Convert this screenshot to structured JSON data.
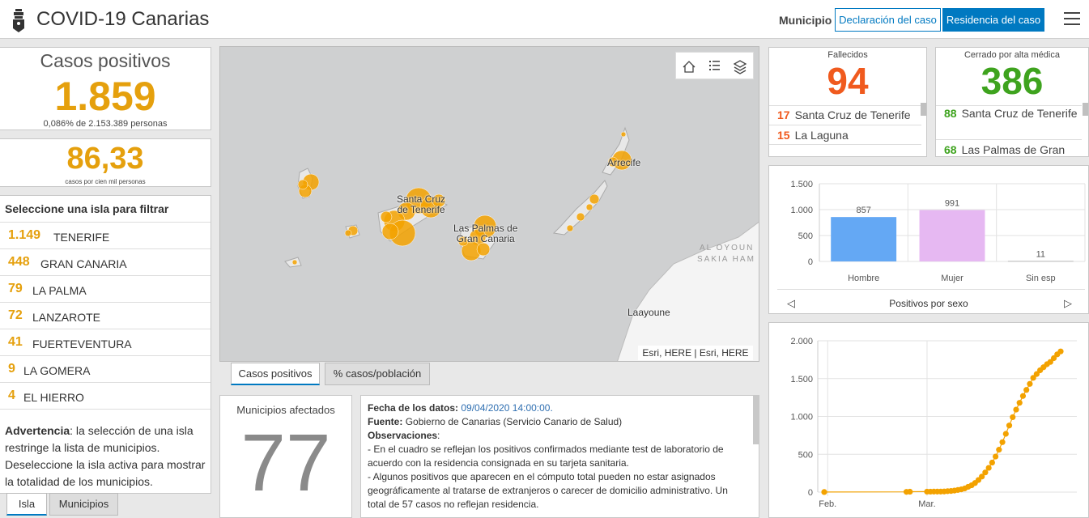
{
  "header": {
    "title": "COVID-19 Canarias",
    "municipio_label": "Municipio",
    "btn_declaracion": "Declaración del caso",
    "btn_residencia": "Residencia del caso"
  },
  "casos": {
    "title": "Casos positivos",
    "value": "1.859",
    "subtitle": "0,086% de 2.153.389 personas"
  },
  "rate": {
    "value": "86,33",
    "subtitle": "casos por cien mil personas"
  },
  "islands": {
    "header": "Seleccione una isla para filtrar",
    "items": [
      {
        "num": "1.149",
        "name": "TENERIFE"
      },
      {
        "num": "448",
        "name": "GRAN CANARIA"
      },
      {
        "num": "79",
        "name": "LA PALMA"
      },
      {
        "num": "72",
        "name": "LANZAROTE"
      },
      {
        "num": "41",
        "name": "FUERTEVENTURA"
      },
      {
        "num": "9",
        "name": "LA GOMERA"
      },
      {
        "num": "4",
        "name": "EL HIERRO"
      }
    ],
    "warning_bold": "Advertencia",
    "warning_text": ": la selección de una isla restringe la lista de municipios. Deseleccione la isla activa para mostrar la totalidad de los municipios."
  },
  "left_tabs": {
    "isla": "Isla",
    "municipios": "Municipios"
  },
  "map": {
    "labels": {
      "santa_cruz": "Santa Cruz\nde Tenerife",
      "las_palmas": "Las Palmas de\nGran Canaria",
      "arrecife": "Arrecife",
      "laayoune": "Laayoune",
      "al_oyoun": "AL OYOUN",
      "sakia": "SAKIA HAM"
    },
    "attribution": "Esri, HERE | Esri, HERE",
    "tab_positivos": "Casos positivos",
    "tab_poblacion": "% casos/población"
  },
  "municipios": {
    "title": "Municipios afectados",
    "value": "77"
  },
  "info": {
    "fecha_label": "Fecha de los datos:",
    "fecha_value": "09/04/2020 14:00:00.",
    "fuente_label": "Fuente:",
    "fuente_value": "Gobierno de Canarias (Servicio Canario de Salud)",
    "obs_label": "Observaciones",
    "obs_1": "- En el cuadro se reflejan los positivos confirmados mediante test de laboratorio de acuerdo con la residencia consignada en su tarjeta sanitaria.",
    "obs_2": "- Algunos positivos que aparecen en el cómputo total pueden no estar asignados geográficamente al tratarse de extranjeros o carecer de domicilio administrativo. Un total de 57 casos no reflejan residencia."
  },
  "fallecidos": {
    "title": "Fallecidos",
    "value": "94",
    "color": "#f05a1e",
    "rows": [
      {
        "num": "17",
        "name": "Santa Cruz de Tenerife"
      },
      {
        "num": "15",
        "name": "La Laguna"
      }
    ]
  },
  "alta": {
    "title": "Cerrado por alta médica",
    "value": "386",
    "color": "#3ea31e",
    "rows": [
      {
        "num": "88",
        "name": "Santa Cruz de Tenerife"
      },
      {
        "num": "68",
        "name": "Las Palmas de Gran"
      }
    ]
  },
  "chart_data": [
    {
      "type": "bar",
      "title": "Positivos por sexo",
      "categories": [
        "Hombre",
        "Mujer",
        "Sin esp"
      ],
      "values": [
        857,
        991,
        11
      ],
      "colors": [
        "#64a8f4",
        "#e6b8f2",
        "#bbbbbb"
      ],
      "ylim": [
        0,
        1500
      ],
      "yticks": [
        "0",
        "500",
        "1.000",
        "1.500"
      ],
      "grid": true
    },
    {
      "type": "scatter",
      "x_tick_labels": [
        "Feb.",
        "Mar."
      ],
      "yticks": [
        "0",
        "500",
        "1.000",
        "1.500",
        "2.000"
      ],
      "ylim": [
        0,
        2000
      ],
      "x": [
        "2020-01-31",
        "2020-02-24",
        "2020-02-25",
        "2020-03-01",
        "2020-03-02",
        "2020-03-03",
        "2020-03-04",
        "2020-03-05",
        "2020-03-06",
        "2020-03-07",
        "2020-03-08",
        "2020-03-09",
        "2020-03-10",
        "2020-03-11",
        "2020-03-12",
        "2020-03-13",
        "2020-03-14",
        "2020-03-15",
        "2020-03-16",
        "2020-03-17",
        "2020-03-18",
        "2020-03-19",
        "2020-03-20",
        "2020-03-21",
        "2020-03-22",
        "2020-03-23",
        "2020-03-24",
        "2020-03-25",
        "2020-03-26",
        "2020-03-27",
        "2020-03-28",
        "2020-03-29",
        "2020-03-30",
        "2020-03-31",
        "2020-04-01",
        "2020-04-02",
        "2020-04-03",
        "2020-04-04",
        "2020-04-05",
        "2020-04-06",
        "2020-04-07",
        "2020-04-08",
        "2020-04-09"
      ],
      "values": [
        1,
        3,
        5,
        6,
        6,
        7,
        7,
        7,
        8,
        12,
        15,
        20,
        28,
        36,
        48,
        70,
        90,
        120,
        160,
        205,
        260,
        320,
        390,
        470,
        560,
        660,
        770,
        880,
        990,
        1090,
        1180,
        1270,
        1350,
        1430,
        1510,
        1560,
        1610,
        1650,
        1690,
        1720,
        1770,
        1820,
        1859
      ],
      "color": "#f3a200",
      "grid": true
    }
  ]
}
